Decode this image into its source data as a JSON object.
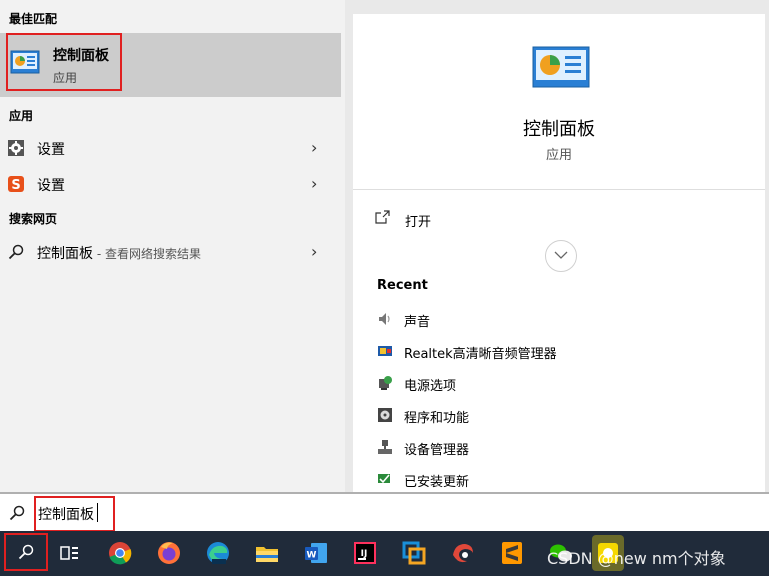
{
  "left": {
    "best_match_heading": "最佳匹配",
    "best_match": {
      "title": "控制面板",
      "subtitle": "应用"
    },
    "apps_heading": "应用",
    "apps": [
      {
        "label": "设置"
      },
      {
        "label": "设置"
      }
    ],
    "web_heading": "搜索网页",
    "web_result": {
      "query": "控制面板",
      "suffix": " - 查看网络搜索结果"
    }
  },
  "right": {
    "title": "控制面板",
    "subtitle": "应用",
    "open_label": "打开",
    "recent_heading": "Recent",
    "recent_items": [
      {
        "label": "声音",
        "icon": "speaker-icon"
      },
      {
        "label": "Realtek高清晰音频管理器",
        "icon": "realtek-icon"
      },
      {
        "label": "电源选项",
        "icon": "power-options-icon"
      },
      {
        "label": "程序和功能",
        "icon": "programs-icon"
      },
      {
        "label": "设备管理器",
        "icon": "device-manager-icon"
      },
      {
        "label": "已安装更新",
        "icon": "installed-updates-icon"
      }
    ]
  },
  "search": {
    "value": "控制面板"
  },
  "taskbar": {
    "apps": [
      "search",
      "task-view",
      "chrome",
      "firefox",
      "edge-beta",
      "file-explorer",
      "word",
      "intellij",
      "app-box",
      "browser-swirl",
      "sublime-text",
      "wechat",
      "app-yellow"
    ]
  },
  "watermark": "CSDN @new nm个对象",
  "colors": {
    "highlight": "#cccccc",
    "red_box": "#e02020",
    "taskbar": "#202b3a"
  }
}
